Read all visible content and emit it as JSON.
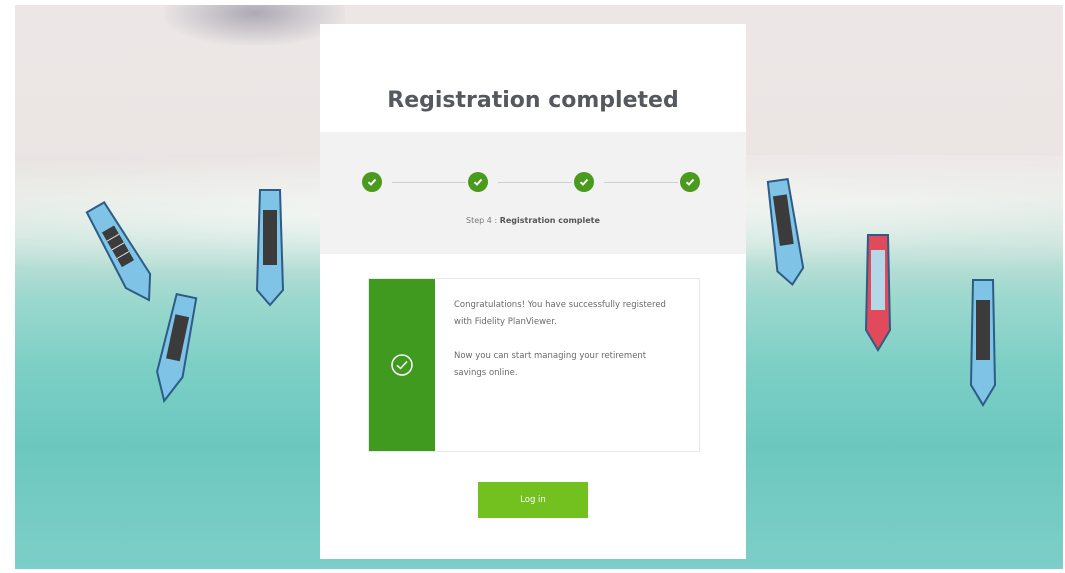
{
  "card": {
    "title": "Registration completed"
  },
  "steps": {
    "count": 4,
    "completed": 4,
    "caption_prefix": "Step 4 : ",
    "caption_emphasis": "Registration complete"
  },
  "message": {
    "paragraph_1": "Congratulations! You have successfully registered with Fidelity PlanViewer.",
    "paragraph_2": "Now you can start managing your retirement savings online."
  },
  "actions": {
    "login_label": "Log in"
  },
  "icons": {
    "step_check": "checkmark-circle-icon",
    "success": "check-circle-outline-icon"
  },
  "colors": {
    "step_green": "#4a9a1e",
    "panel_green": "#3f9a1f",
    "button_green": "#72c11e",
    "title_text": "#55585e"
  }
}
